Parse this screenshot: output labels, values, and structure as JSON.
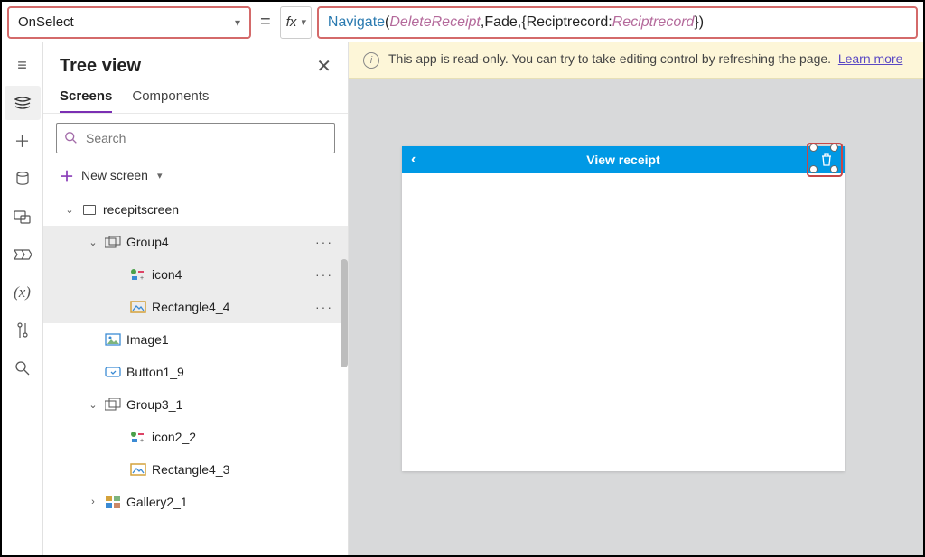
{
  "topbar": {
    "property": "OnSelect",
    "fx_label": "fx",
    "formula_tokens": [
      {
        "t": "fn",
        "v": "Navigate"
      },
      {
        "t": "plain",
        "v": "("
      },
      {
        "t": "id",
        "v": "DeleteReceipt"
      },
      {
        "t": "plain",
        "v": ",Fade,{Reciptrecord:"
      },
      {
        "t": "id",
        "v": "Reciptrecord"
      },
      {
        "t": "plain",
        "v": "})"
      }
    ]
  },
  "rail": {
    "items": [
      "menu",
      "layers",
      "plus",
      "data",
      "media",
      "flow",
      "var",
      "tools",
      "search"
    ]
  },
  "panel": {
    "title": "Tree view",
    "tabs": {
      "screens": "Screens",
      "components": "Components"
    },
    "search_placeholder": "Search",
    "new_screen": "New screen"
  },
  "tree": [
    {
      "level": 1,
      "kind": "screen",
      "label": "recepitscreen",
      "expanded": true
    },
    {
      "level": 2,
      "kind": "group",
      "label": "Group4",
      "expanded": true,
      "dots": true,
      "selected": true
    },
    {
      "level": 3,
      "kind": "mix",
      "label": "icon4",
      "dots": true,
      "selected": true
    },
    {
      "level": 3,
      "kind": "rect",
      "label": "Rectangle4_4",
      "dots": true,
      "selected": true
    },
    {
      "level": 2,
      "kind": "img",
      "label": "Image1"
    },
    {
      "level": 2,
      "kind": "btn",
      "label": "Button1_9"
    },
    {
      "level": 2,
      "kind": "group",
      "label": "Group3_1",
      "expanded": true
    },
    {
      "level": 3,
      "kind": "mix",
      "label": "icon2_2"
    },
    {
      "level": 3,
      "kind": "rect",
      "label": "Rectangle4_3"
    },
    {
      "level": 2,
      "kind": "gal",
      "label": "Gallery2_1",
      "expanded": false
    }
  ],
  "canvas": {
    "info_text": "This app is read-only. You can try to take editing control by refreshing the page.",
    "info_link": "Learn more",
    "app_title": "View receipt"
  }
}
